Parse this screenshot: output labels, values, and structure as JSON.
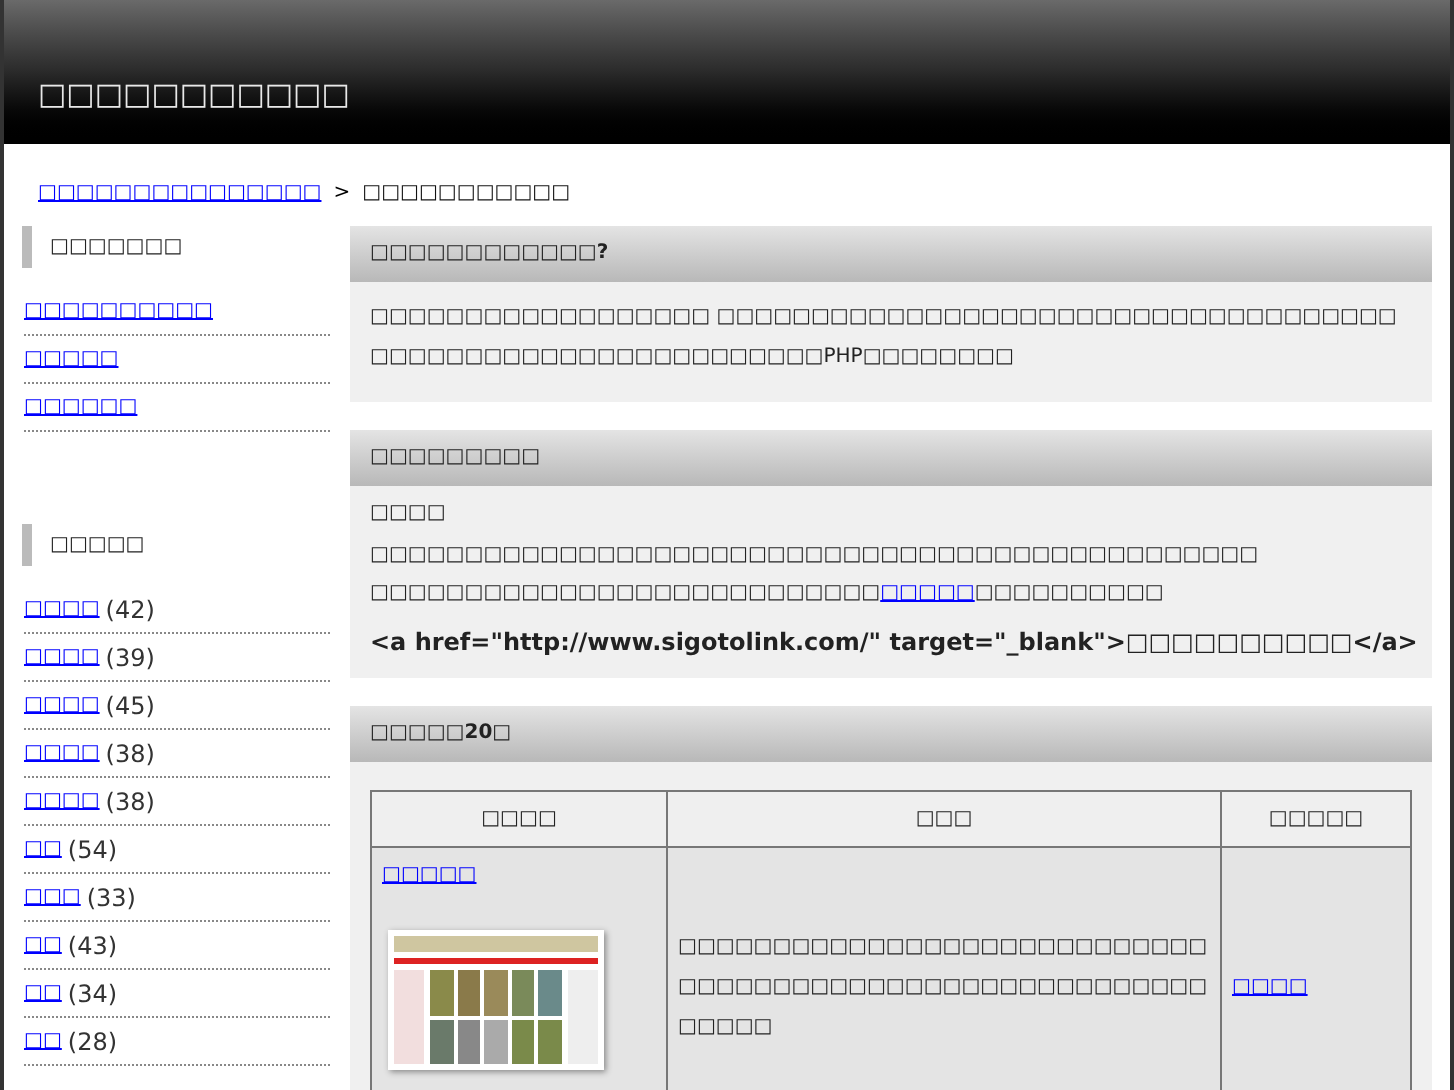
{
  "header": {
    "title": "□□□□□□□□□□□"
  },
  "breadcrumb": {
    "link": "□□□□□□□□□□□□□□□",
    "separator": ">",
    "current": "□□□□□□□□□□□"
  },
  "sidebar": {
    "sections": [
      {
        "heading": "□□□□□□□",
        "items": [
          {
            "label": "□□□□□□□□□□"
          },
          {
            "label": "□□□□□"
          },
          {
            "label": "□□□□□□"
          }
        ]
      },
      {
        "heading": "□□□□□",
        "items": [
          {
            "label": "□□□□",
            "count": "(42)"
          },
          {
            "label": "□□□□",
            "count": "(39)"
          },
          {
            "label": "□□□□",
            "count": "(45)"
          },
          {
            "label": "□□□□",
            "count": "(38)"
          },
          {
            "label": "□□□□",
            "count": "(38)"
          },
          {
            "label": "□□",
            "count": "(54)"
          },
          {
            "label": "□□□",
            "count": "(33)"
          },
          {
            "label": "□□",
            "count": "(43)"
          },
          {
            "label": "□□",
            "count": "(34)"
          },
          {
            "label": "□□",
            "count": "(28)"
          }
        ]
      }
    ]
  },
  "panels": [
    {
      "kind": "text",
      "heading": "□□□□□□□□□□□□?",
      "paragraph": "□□□□□□□□□□□□□□□□□□ □□□□□□□□□□□□□□□□□□□□□□□□□□□□□□□□□□□□□□□□□□□□□□□□□□□□□□□□□□□□PHP□□□□□□□□"
    },
    {
      "kind": "link-code",
      "heading": "□□□□□□□□□",
      "subheading": "□□□□",
      "line_1": "□□□□□□□□□□□□□□□□□□□□□□□□□□□□□□□□□□□□□□□□□□□□□□□",
      "line_2_before": "□□□□□□□□□□□□□□□□□□□□□□□□□□□",
      "line_2_link": "□□□□□",
      "line_2_after": "□□□□□□□□□□",
      "code": "<a href=\"http://www.sigotolink.com/\" target=\"_blank\">□□□□□□□□□□</a>"
    },
    {
      "kind": "table",
      "heading": "□□□□□20□",
      "columns": [
        "□□□□",
        "□□□",
        "□□□□□"
      ],
      "rows": [
        {
          "site": "□□□□□",
          "description": "□□□□□□□□□□□□□□□□□□□□□□□□□□□□□□□□□□□□□□□□□□□□□□□□□□□□□□□□□□□□□",
          "category": "□□□□"
        }
      ]
    }
  ]
}
